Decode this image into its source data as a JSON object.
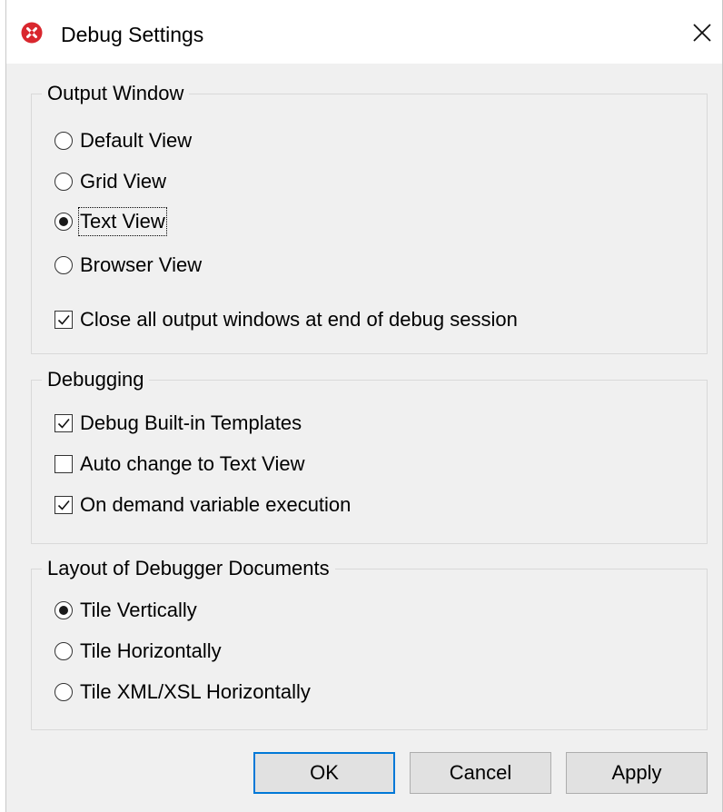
{
  "window": {
    "title": "Debug Settings",
    "icon": "altova-x-icon",
    "accent_color": "#d9272e"
  },
  "output_window": {
    "legend": "Output Window",
    "options": [
      {
        "label": "Default View",
        "selected": false
      },
      {
        "label": "Grid View",
        "selected": false
      },
      {
        "label": "Text View",
        "selected": true
      },
      {
        "label": "Browser View",
        "selected": false
      }
    ],
    "close_all": {
      "label": "Close all output windows at end of debug session",
      "checked": true
    }
  },
  "debugging": {
    "legend": "Debugging",
    "options": [
      {
        "label": "Debug Built-in Templates",
        "checked": true
      },
      {
        "label": "Auto change to Text View",
        "checked": false
      },
      {
        "label": "On demand variable execution",
        "checked": true
      }
    ]
  },
  "layout": {
    "legend": "Layout of Debugger Documents",
    "options": [
      {
        "label": "Tile Vertically",
        "selected": true
      },
      {
        "label": "Tile Horizontally",
        "selected": false
      },
      {
        "label": "Tile XML/XSL Horizontally",
        "selected": false
      }
    ]
  },
  "buttons": {
    "ok": "OK",
    "cancel": "Cancel",
    "apply": "Apply",
    "default_color": "#0078d7"
  }
}
